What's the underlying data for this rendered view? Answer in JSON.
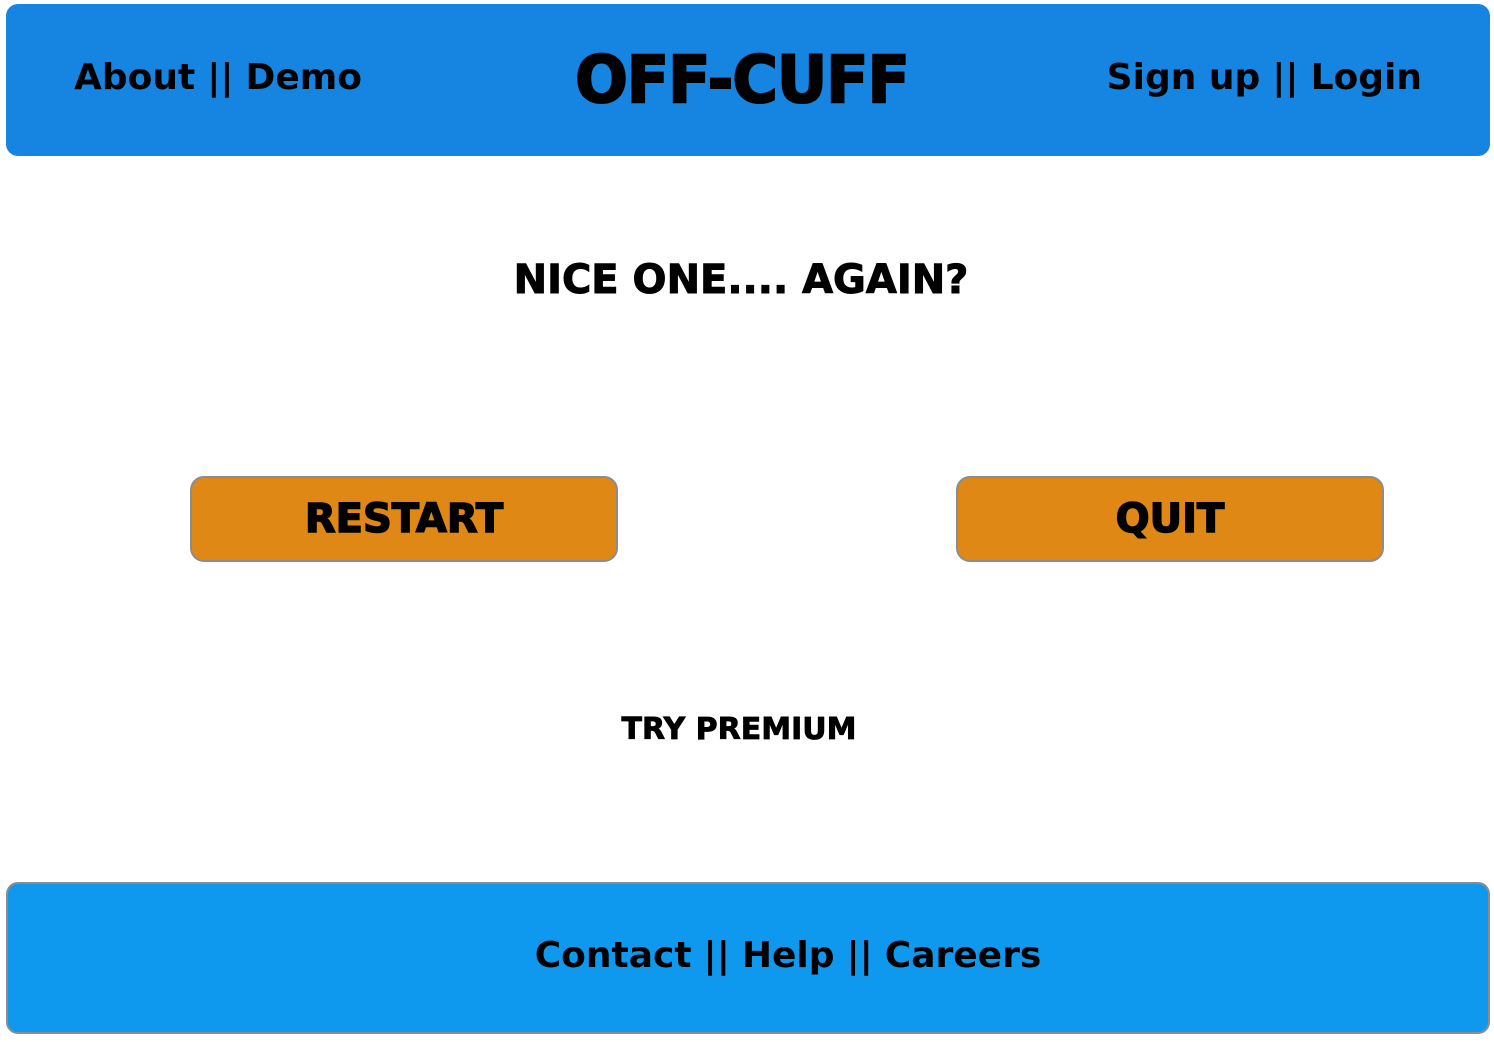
{
  "header": {
    "logo": "OFF-CUFF",
    "nav_left": {
      "about": "About",
      "demo": "Demo"
    },
    "nav_right": {
      "signup": "Sign up",
      "login": "Login"
    },
    "separator": "||"
  },
  "main": {
    "headline": "NICE ONE.... AGAIN?",
    "restart_label": "RESTART",
    "quit_label": "QUIT",
    "premium_label": "TRY PREMIUM"
  },
  "footer": {
    "contact": "Contact",
    "help": "Help",
    "careers": "Careers",
    "separator": "||"
  },
  "colors": {
    "header_bg": "#1585e1",
    "footer_bg": "#0f99ee",
    "button_bg": "#e08815"
  }
}
